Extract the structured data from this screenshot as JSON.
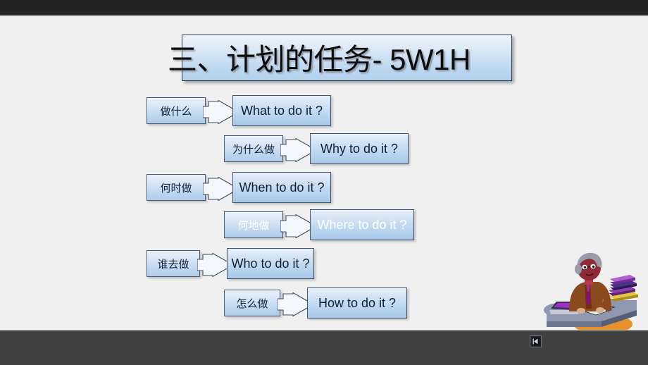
{
  "window": {
    "top_bar_color": "#242424",
    "bottom_bar_color": "#414141",
    "slide_background": "#f0f0f0"
  },
  "nav": {
    "previous_icon": "previous-slide-icon",
    "previous_label": "Previous"
  },
  "slide": {
    "title": "三、计划的任务- 5W1H",
    "title_accent_color": "#b3d1ec",
    "box_border_color": "#2b3b52",
    "rows": [
      {
        "cn": "做什么",
        "en": "What to do it ?",
        "style": "dark",
        "indent": "left"
      },
      {
        "cn": "为什么做",
        "en": "Why to do it ?",
        "style": "dark",
        "indent": "right"
      },
      {
        "cn": "何时做",
        "en": "When to do it ?",
        "style": "dark",
        "indent": "left"
      },
      {
        "cn": "何地做",
        "en": "Where to do it ?",
        "style": "light",
        "indent": "right"
      },
      {
        "cn": "谁去做",
        "en": "Who to do it ?",
        "style": "dark",
        "indent": "left"
      },
      {
        "cn": "怎么做",
        "en": "How to do it ?",
        "style": "dark",
        "indent": "right"
      }
    ],
    "clipart": "person-studying-at-desk-with-books-illustration"
  }
}
